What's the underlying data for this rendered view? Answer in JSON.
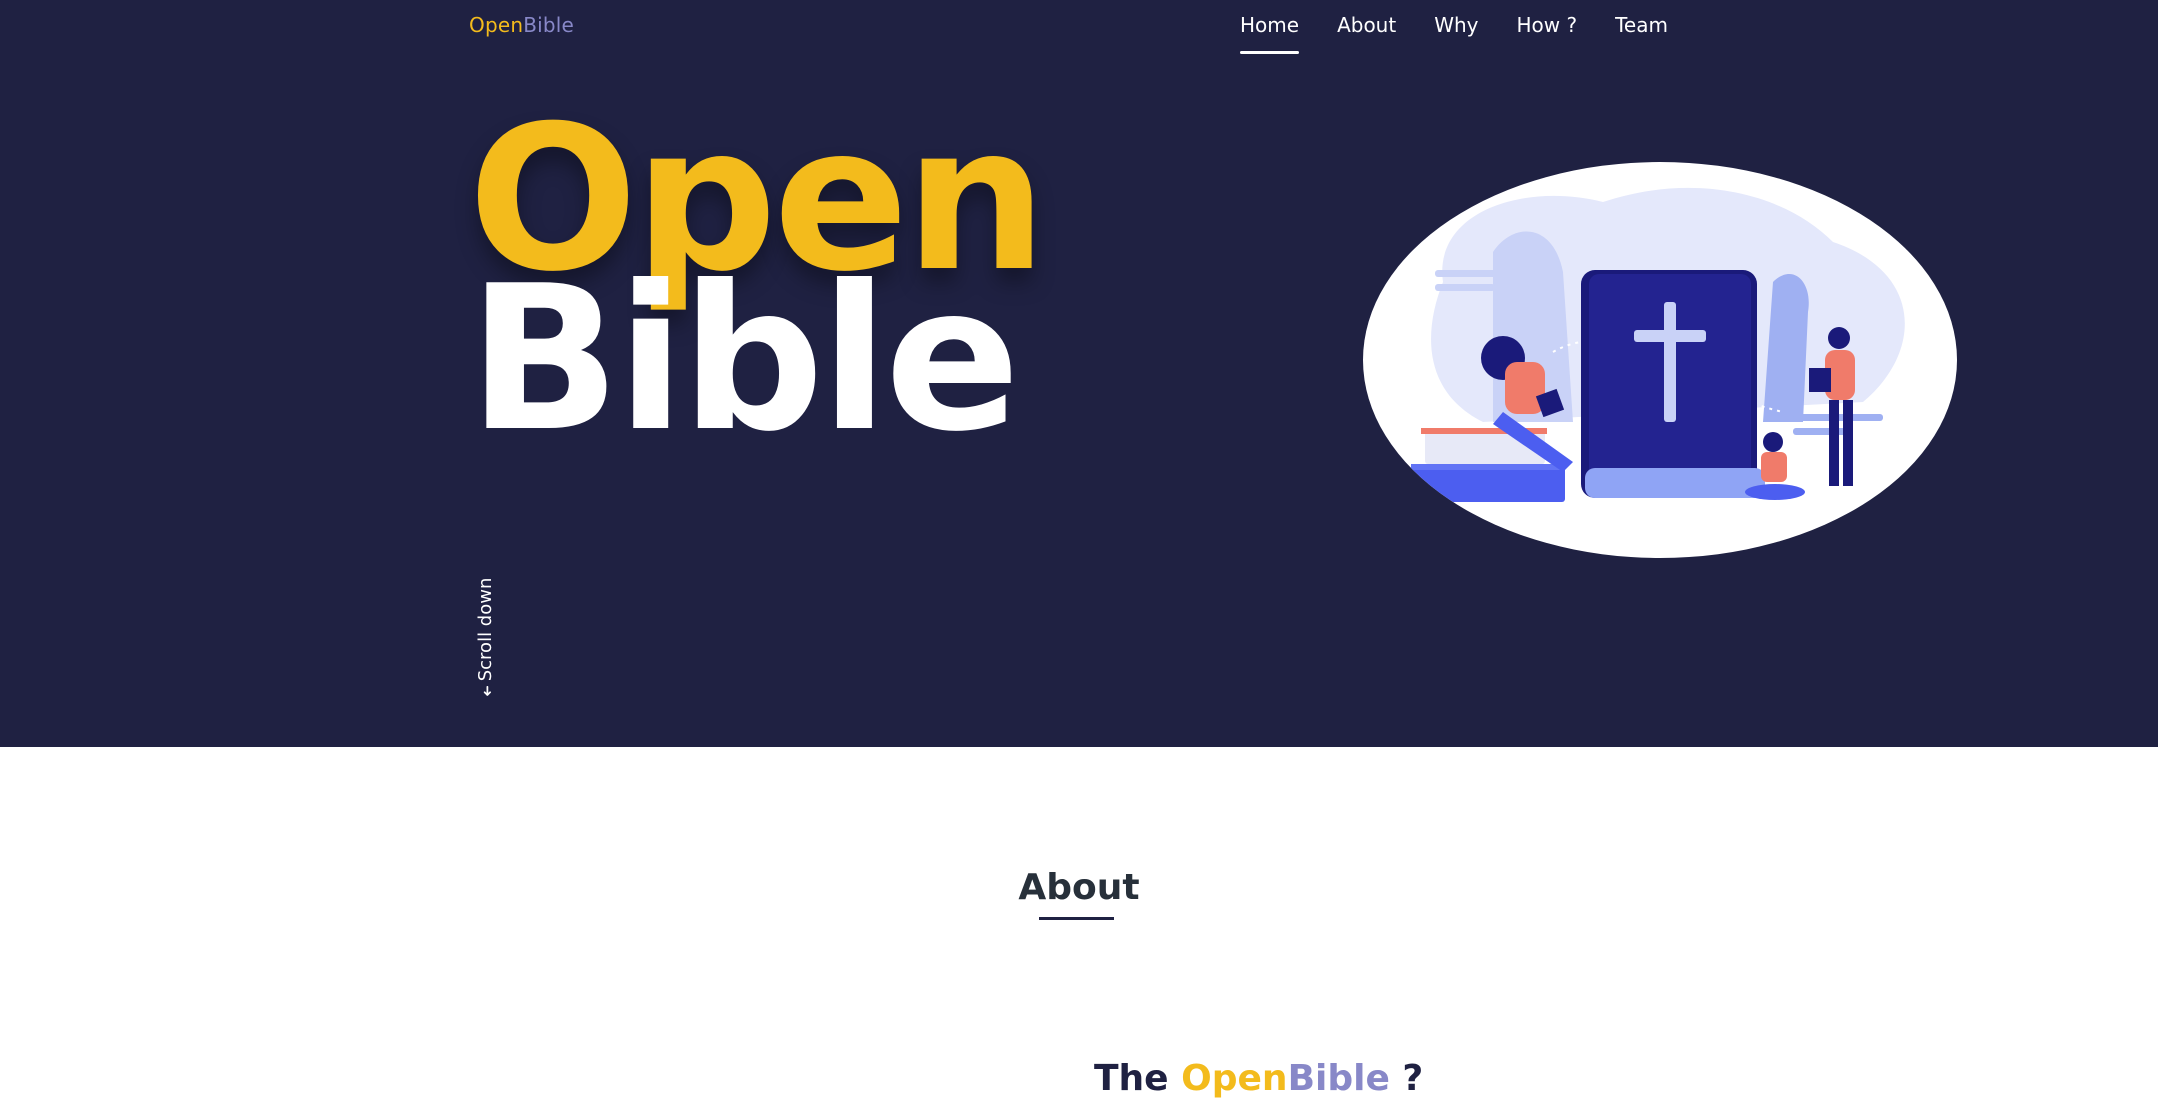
{
  "header": {
    "logo_open": "Open",
    "logo_bible": "Bible",
    "nav": [
      {
        "label": "Home",
        "active": true
      },
      {
        "label": "About",
        "active": false
      },
      {
        "label": "Why",
        "active": false
      },
      {
        "label": "How ?",
        "active": false
      },
      {
        "label": "Team",
        "active": false
      }
    ]
  },
  "hero": {
    "title_open": "Open",
    "title_bible": "Bible",
    "scroll_label": "Scroll down",
    "scroll_arrow": "➜"
  },
  "about": {
    "heading": "About",
    "sub_prefix": "The ",
    "sub_open": "Open",
    "sub_bible": "Bible",
    "sub_suffix": " ?"
  },
  "colors": {
    "hero_bg": "#1f2142",
    "accent_yellow": "#f3bb1c",
    "accent_purple": "#8888c8",
    "text_dark": "#27303a"
  },
  "icons": [
    "arrow-down-icon",
    "bible-illustration"
  ]
}
